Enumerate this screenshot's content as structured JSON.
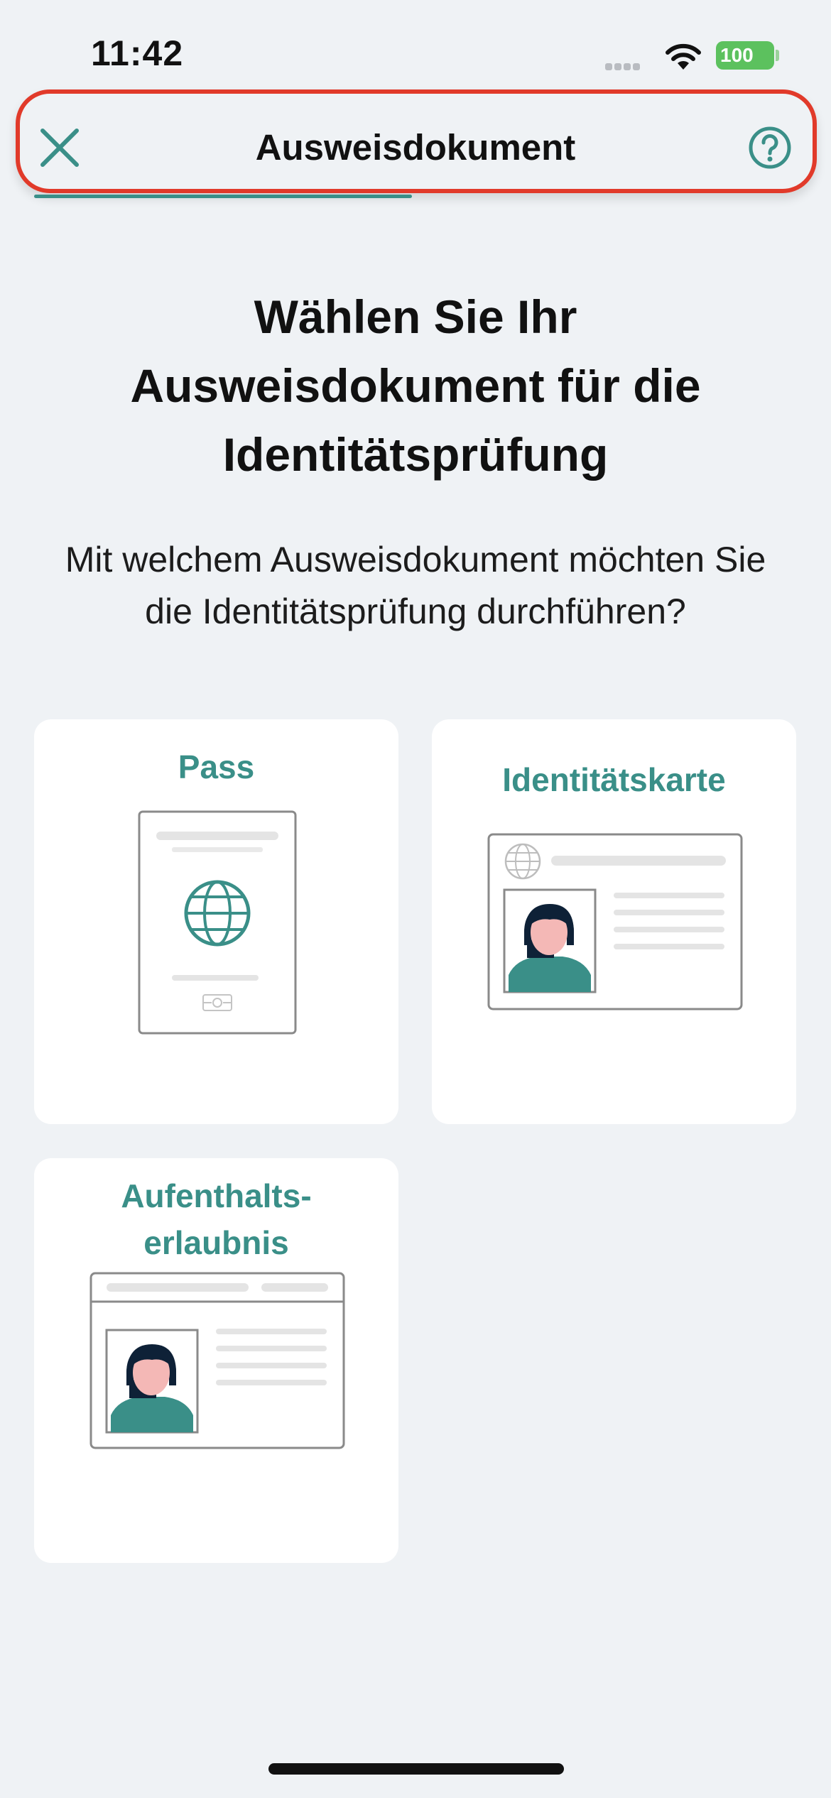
{
  "status_bar": {
    "time": "11:42",
    "battery": "100"
  },
  "header": {
    "title": "Ausweisdokument"
  },
  "main": {
    "headline": "Wählen Sie Ihr Ausweisdokument für die Identitätsprüfung",
    "subheadline": "Mit welchem Ausweisdokument möchten Sie die Identitätsprüfung durchführen?"
  },
  "options": [
    {
      "label": "Pass",
      "icon": "passport-illustration"
    },
    {
      "label": "Identitätskarte",
      "icon": "id-card-illustration"
    },
    {
      "label": "Aufenthalts-\nerlaubnis",
      "icon": "residence-permit-illustration"
    }
  ],
  "colors": {
    "accent": "#3a8f88",
    "background": "#eff2f5",
    "highlight": "#e13a2a",
    "battery": "#5cc15e"
  }
}
